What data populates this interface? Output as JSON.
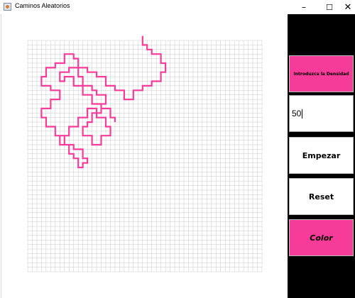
{
  "window": {
    "title": "Caminos Aleatorios",
    "minimize_symbol": "–",
    "maximize_symbol": "☐",
    "close_symbol": "✕"
  },
  "colors": {
    "accent": "#f73b98",
    "grid_line": "#c8c8c8",
    "panel_background": "#000000"
  },
  "grid": {
    "cols": 51,
    "rows": 51
  },
  "walk_path": [
    [
      25,
      -1
    ],
    [
      25,
      1
    ],
    [
      26,
      1
    ],
    [
      26,
      2
    ],
    [
      27,
      2
    ],
    [
      27,
      3
    ],
    [
      29,
      3
    ],
    [
      29,
      5
    ],
    [
      30,
      5
    ],
    [
      30,
      7
    ],
    [
      29,
      7
    ],
    [
      29,
      9
    ],
    [
      27,
      9
    ],
    [
      27,
      10
    ],
    [
      25,
      10
    ],
    [
      25,
      11
    ],
    [
      23,
      11
    ],
    [
      23,
      13
    ],
    [
      21,
      13
    ],
    [
      21,
      11
    ],
    [
      19,
      11
    ],
    [
      19,
      10
    ],
    [
      17,
      10
    ],
    [
      17,
      8
    ],
    [
      15,
      8
    ],
    [
      15,
      7
    ],
    [
      13,
      7
    ],
    [
      13,
      6
    ],
    [
      11,
      6
    ],
    [
      11,
      4
    ],
    [
      10,
      4
    ],
    [
      10,
      3
    ],
    [
      8,
      3
    ],
    [
      8,
      5
    ],
    [
      6,
      5
    ],
    [
      6,
      6
    ],
    [
      4,
      6
    ],
    [
      4,
      8
    ],
    [
      3,
      8
    ],
    [
      3,
      10
    ],
    [
      5,
      10
    ],
    [
      5,
      11
    ],
    [
      7,
      11
    ],
    [
      7,
      13
    ],
    [
      5,
      13
    ],
    [
      5,
      15
    ],
    [
      3,
      15
    ],
    [
      3,
      17
    ],
    [
      4,
      17
    ],
    [
      4,
      19
    ],
    [
      6,
      19
    ],
    [
      6,
      21
    ],
    [
      8,
      21
    ],
    [
      8,
      23
    ],
    [
      10,
      23
    ],
    [
      10,
      24
    ],
    [
      12,
      24
    ],
    [
      12,
      26
    ],
    [
      13,
      26
    ],
    [
      13,
      27
    ],
    [
      12,
      27
    ],
    [
      12,
      28
    ],
    [
      11,
      28
    ],
    [
      11,
      26
    ],
    [
      10,
      26
    ],
    [
      10,
      25
    ],
    [
      9,
      25
    ],
    [
      9,
      23
    ],
    [
      7,
      23
    ],
    [
      7,
      21
    ],
    [
      9,
      21
    ],
    [
      9,
      19
    ],
    [
      11,
      19
    ],
    [
      11,
      17
    ],
    [
      13,
      17
    ],
    [
      13,
      15
    ],
    [
      15,
      15
    ],
    [
      15,
      17
    ],
    [
      17,
      17
    ],
    [
      17,
      19
    ],
    [
      18,
      19
    ],
    [
      18,
      21
    ],
    [
      16,
      21
    ],
    [
      16,
      23
    ],
    [
      14,
      23
    ],
    [
      14,
      21
    ],
    [
      12,
      21
    ],
    [
      12,
      19
    ],
    [
      13,
      19
    ],
    [
      13,
      18
    ],
    [
      14,
      18
    ],
    [
      14,
      16
    ],
    [
      16,
      16
    ],
    [
      16,
      14
    ],
    [
      14,
      14
    ],
    [
      14,
      12
    ],
    [
      12,
      12
    ],
    [
      12,
      10
    ],
    [
      10,
      10
    ],
    [
      10,
      8
    ],
    [
      8,
      8
    ],
    [
      8,
      9
    ],
    [
      7,
      9
    ],
    [
      7,
      7
    ],
    [
      9,
      7
    ],
    [
      9,
      6
    ],
    [
      11,
      6
    ],
    [
      11,
      8
    ],
    [
      12,
      8
    ],
    [
      12,
      10
    ],
    [
      14,
      10
    ],
    [
      14,
      11
    ],
    [
      15,
      11
    ],
    [
      15,
      12
    ],
    [
      17,
      12
    ],
    [
      17,
      14
    ],
    [
      16,
      14
    ],
    [
      16,
      15
    ],
    [
      18,
      15
    ],
    [
      18,
      17
    ],
    [
      19,
      17
    ],
    [
      19,
      18
    ]
  ],
  "side_panel": {
    "density_label": "Introduzca la Densidad",
    "density_value": "50",
    "start_button": "Empezar",
    "reset_button": "Reset",
    "color_button": "Color"
  }
}
